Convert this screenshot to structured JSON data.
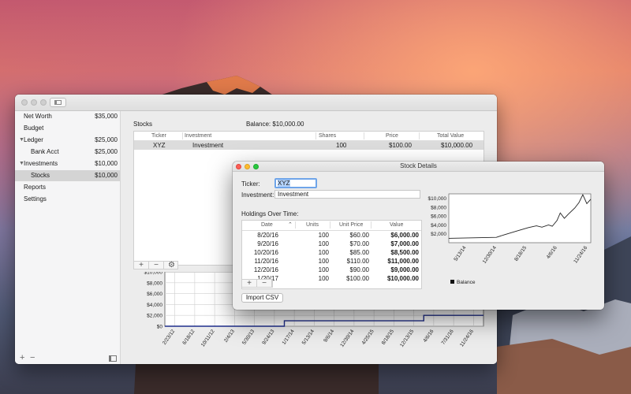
{
  "sidebar": {
    "items": [
      {
        "label": "Net Worth",
        "value": "$35,000"
      },
      {
        "label": "Budget",
        "value": ""
      },
      {
        "label": "Ledger",
        "value": "$25,000"
      },
      {
        "label": "Bank Acct",
        "value": "$25,000"
      },
      {
        "label": "Investments",
        "value": "$10,000"
      },
      {
        "label": "Stocks",
        "value": "$10,000"
      },
      {
        "label": "Reports",
        "value": ""
      },
      {
        "label": "Settings",
        "value": ""
      }
    ],
    "footer": {
      "add": "+",
      "remove": "−"
    }
  },
  "stocks": {
    "title": "Stocks",
    "balance": "Balance:  $10,000.00",
    "headers": [
      "Ticker",
      "Investment",
      "Shares",
      "Price",
      "Total Value"
    ],
    "row": {
      "ticker": "XYZ",
      "investment": "Investment",
      "shares": "100",
      "price": "$100.00",
      "total": "$10,000.00"
    },
    "toolbar": {
      "add": "+",
      "remove": "−"
    }
  },
  "detail": {
    "title": "Stock Details",
    "ticker_label": "Ticker:",
    "ticker_value": "XYZ",
    "investment_label": "Investment:",
    "investment_value": "Investment",
    "holdings_label": "Holdings Over Time:",
    "holdings_headers": [
      "Date",
      "Units",
      "Unit Price",
      "Value"
    ],
    "holdings_rows": [
      {
        "date": "8/20/16",
        "units": "100",
        "price": "$60.00",
        "value": "$6,000.00"
      },
      {
        "date": "9/20/16",
        "units": "100",
        "price": "$70.00",
        "value": "$7,000.00"
      },
      {
        "date": "10/20/16",
        "units": "100",
        "price": "$85.00",
        "value": "$8,500.00"
      },
      {
        "date": "11/20/16",
        "units": "100",
        "price": "$110.00",
        "value": "$11,000.00"
      },
      {
        "date": "12/20/16",
        "units": "100",
        "price": "$90.00",
        "value": "$9,000.00"
      },
      {
        "date": "1/20/17",
        "units": "100",
        "price": "$100.00",
        "value": "$10,000.00"
      }
    ],
    "toolbar": {
      "add": "+",
      "remove": "−"
    },
    "import_button": "Import CSV"
  },
  "colors": {
    "series_main": "#1f2e8c",
    "series_detail": "#222222",
    "selection": "#b4d3fb"
  },
  "chart_data": [
    {
      "type": "line",
      "x": [
        "2/23/12",
        "6/18/12",
        "10/11/12",
        "2/4/13",
        "5/30/13",
        "9/24/13",
        "1/17/14",
        "5/13/14",
        "9/6/14",
        "12/30/14",
        "4/25/15",
        "8/18/15",
        "12/13/15",
        "4/6/16",
        "7/31/16",
        "11/24/16"
      ],
      "y_ticks": [
        "$10,000",
        "$8,000",
        "$6,000",
        "$4,000",
        "$2,000",
        "$0"
      ],
      "ylim": [
        0,
        10000
      ],
      "series": [
        {
          "values": [
            0,
            0,
            0,
            0,
            0,
            0,
            1000,
            1000,
            1000,
            1000,
            1000,
            1000,
            1000,
            2000,
            2000,
            2000
          ]
        }
      ],
      "grid": true
    },
    {
      "type": "line",
      "x": [
        "5/13/14",
        "12/30/14",
        "8/18/15",
        "4/6/16",
        "11/24/16"
      ],
      "y_ticks": [
        "$10,000",
        "$8,000",
        "$6,000",
        "$4,000",
        "$2,000"
      ],
      "ylim": [
        0,
        11000
      ],
      "series": [
        {
          "name": "Balance",
          "points": [
            [
              "1/1/14",
              1000
            ],
            [
              "7/1/14",
              1100
            ],
            [
              "12/30/14",
              1200
            ],
            [
              "3/1/15",
              1800
            ],
            [
              "6/1/15",
              2600
            ],
            [
              "9/1/15",
              3400
            ],
            [
              "11/1/15",
              3800
            ],
            [
              "12/13/15",
              3500
            ],
            [
              "2/1/16",
              4000
            ],
            [
              "3/1/16",
              3700
            ],
            [
              "4/6/16",
              5000
            ],
            [
              "5/1/16",
              6700
            ],
            [
              "6/1/16",
              5500
            ],
            [
              "7/1/16",
              6400
            ],
            [
              "8/20/16",
              7800
            ],
            [
              "9/20/16",
              9000
            ],
            [
              "10/20/16",
              10800
            ],
            [
              "11/20/16",
              8800
            ],
            [
              "12/20/16",
              9800
            ]
          ]
        }
      ],
      "legend": "bottom-left"
    }
  ]
}
